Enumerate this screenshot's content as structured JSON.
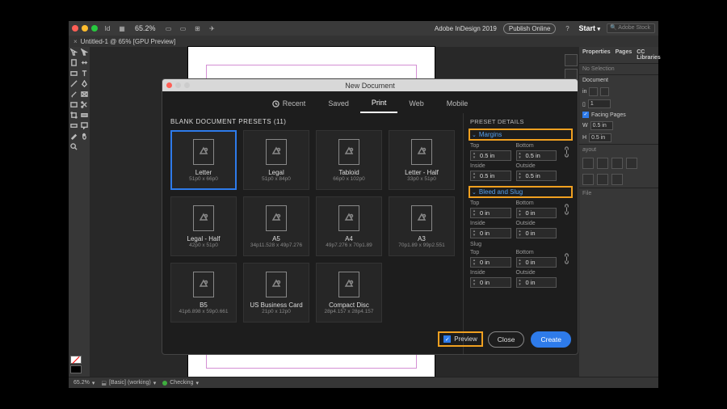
{
  "app_title": "Adobe InDesign 2019",
  "menubar": {
    "zoom": "65.2%",
    "publish": "Publish Online",
    "start": "Start",
    "search_placeholder": "Adobe Stock"
  },
  "tab": {
    "label": "Untitled-1 @ 65% [GPU Preview]",
    "close": "×"
  },
  "right_panel": {
    "tabs": [
      "Properties",
      "Pages",
      "CC Libraries"
    ],
    "no_selection": "No Selection",
    "document": "Document",
    "units": "in",
    "w_value": "0.5 in",
    "h_value": "0.5 in",
    "pages_field": "1",
    "facing": "Facing Pages",
    "layout": "ayout",
    "file": "File"
  },
  "statusbar": {
    "zoom": "65.2%",
    "layer": "[Basic] (working)",
    "status": "Checking"
  },
  "modal": {
    "title": "New Document",
    "tabs": {
      "recent": "Recent",
      "saved": "Saved",
      "print": "Print",
      "web": "Web",
      "mobile": "Mobile"
    },
    "presets_header": "BLANK DOCUMENT PRESETS  (11)",
    "presets": [
      {
        "name": "Letter",
        "dim": "51p0 x 66p0",
        "selected": true
      },
      {
        "name": "Legal",
        "dim": "51p0 x 84p0"
      },
      {
        "name": "Tabloid",
        "dim": "66p0 x 102p0"
      },
      {
        "name": "Letter - Half",
        "dim": "33p0 x 51p0"
      },
      {
        "name": "Legal - Half",
        "dim": "42p0 x 51p0"
      },
      {
        "name": "A5",
        "dim": "34p11.528 x 49p7.276"
      },
      {
        "name": "A4",
        "dim": "49p7.276 x 70p1.89"
      },
      {
        "name": "A3",
        "dim": "70p1.89 x 99p2.551"
      },
      {
        "name": "B5",
        "dim": "41p6.898 x 59p0.661"
      },
      {
        "name": "US Business Card",
        "dim": "21p0 x 12p0"
      },
      {
        "name": "Compact Disc",
        "dim": "28p4.157 x 28p4.157"
      }
    ],
    "details": {
      "header": "PRESET DETAILS",
      "margins_label": "Margins",
      "top": "Top",
      "bottom": "Bottom",
      "inside": "Inside",
      "outside": "Outside",
      "m_top": "0.5 in",
      "m_bottom": "0.5 in",
      "m_inside": "0.5 in",
      "m_outside": "0.5 in",
      "bleed_label": "Bleed and Slug",
      "b_top": "0 in",
      "b_bottom": "0 in",
      "b_inside": "0 in",
      "b_outside": "0 in",
      "slug": "Slug",
      "s_top": "0 in",
      "s_bottom": "0 in",
      "s_inside": "0 in",
      "s_outside": "0 in"
    },
    "footer": {
      "preview": "Preview",
      "close": "Close",
      "create": "Create"
    }
  }
}
